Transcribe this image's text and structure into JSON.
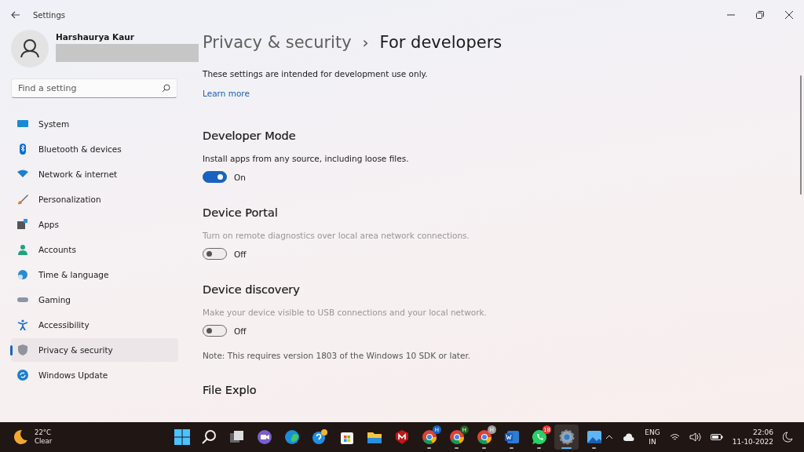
{
  "window": {
    "title": "Settings"
  },
  "profile": {
    "name": "Harshaurya Kaur"
  },
  "search": {
    "placeholder": "Find a setting"
  },
  "sidebar": {
    "items": [
      {
        "label": "System",
        "kind": "system",
        "selected": false
      },
      {
        "label": "Bluetooth & devices",
        "kind": "bluetooth",
        "selected": false
      },
      {
        "label": "Network & internet",
        "kind": "wifi",
        "selected": false
      },
      {
        "label": "Personalization",
        "kind": "brush",
        "selected": false
      },
      {
        "label": "Apps",
        "kind": "apps",
        "selected": false
      },
      {
        "label": "Accounts",
        "kind": "person",
        "selected": false
      },
      {
        "label": "Time & language",
        "kind": "globe",
        "selected": false
      },
      {
        "label": "Gaming",
        "kind": "gamepad",
        "selected": false
      },
      {
        "label": "Accessibility",
        "kind": "access",
        "selected": false
      },
      {
        "label": "Privacy & security",
        "kind": "shield",
        "selected": true
      },
      {
        "label": "Windows Update",
        "kind": "update",
        "selected": false
      }
    ]
  },
  "breadcrumb": {
    "parent": "Privacy & security",
    "separator": "›",
    "current": "For developers"
  },
  "intro": "These settings are intended for development use only.",
  "learn_more": "Learn more",
  "settings": [
    {
      "title": "Developer Mode",
      "description": "Install apps from any source, including loose files.",
      "disabled": false,
      "on": true,
      "state": "On"
    },
    {
      "title": "Device Portal",
      "description": "Turn on remote diagnostics over local area network connections.",
      "disabled": true,
      "on": false,
      "state": "Off"
    },
    {
      "title": "Device discovery",
      "description": "Make your device visible to USB connections and your local network.",
      "disabled": true,
      "on": false,
      "state": "Off",
      "note": "Note: This requires version 1803 of the Windows 10 SDK or later."
    },
    {
      "title": "File Explo"
    }
  ],
  "taskbar": {
    "weather": {
      "temp": "22°C",
      "condition": "Clear"
    },
    "apps": [
      {
        "kind": "start",
        "running": false,
        "selected": false
      },
      {
        "kind": "search",
        "running": false,
        "selected": false
      },
      {
        "kind": "taskview",
        "running": false,
        "selected": false
      },
      {
        "kind": "chat",
        "running": false,
        "selected": false
      },
      {
        "kind": "edge",
        "running": false,
        "selected": false
      },
      {
        "kind": "help",
        "running": false,
        "selected": false
      },
      {
        "kind": "store",
        "running": false,
        "selected": false
      },
      {
        "kind": "folder",
        "running": false,
        "selected": false
      },
      {
        "kind": "mcafee",
        "running": false,
        "selected": false
      },
      {
        "kind": "chrome",
        "badge": "H",
        "color": "#1565c0",
        "running": true,
        "selected": false
      },
      {
        "kind": "chrome",
        "badge": "H",
        "color": "#1b5e20",
        "running": true,
        "selected": false
      },
      {
        "kind": "chrome",
        "badge": "H",
        "color": "#9e9e9e",
        "running": true,
        "selected": false
      },
      {
        "kind": "word",
        "running": true,
        "selected": false
      },
      {
        "kind": "whatsapp",
        "badge": "18",
        "color": "#e53935",
        "running": true,
        "selected": false
      },
      {
        "kind": "settings",
        "running": true,
        "selected": true
      },
      {
        "kind": "photos",
        "running": true,
        "selected": false
      }
    ],
    "language": "ENG",
    "region": "IN",
    "time": "22:06",
    "date": "11-10-2022"
  }
}
